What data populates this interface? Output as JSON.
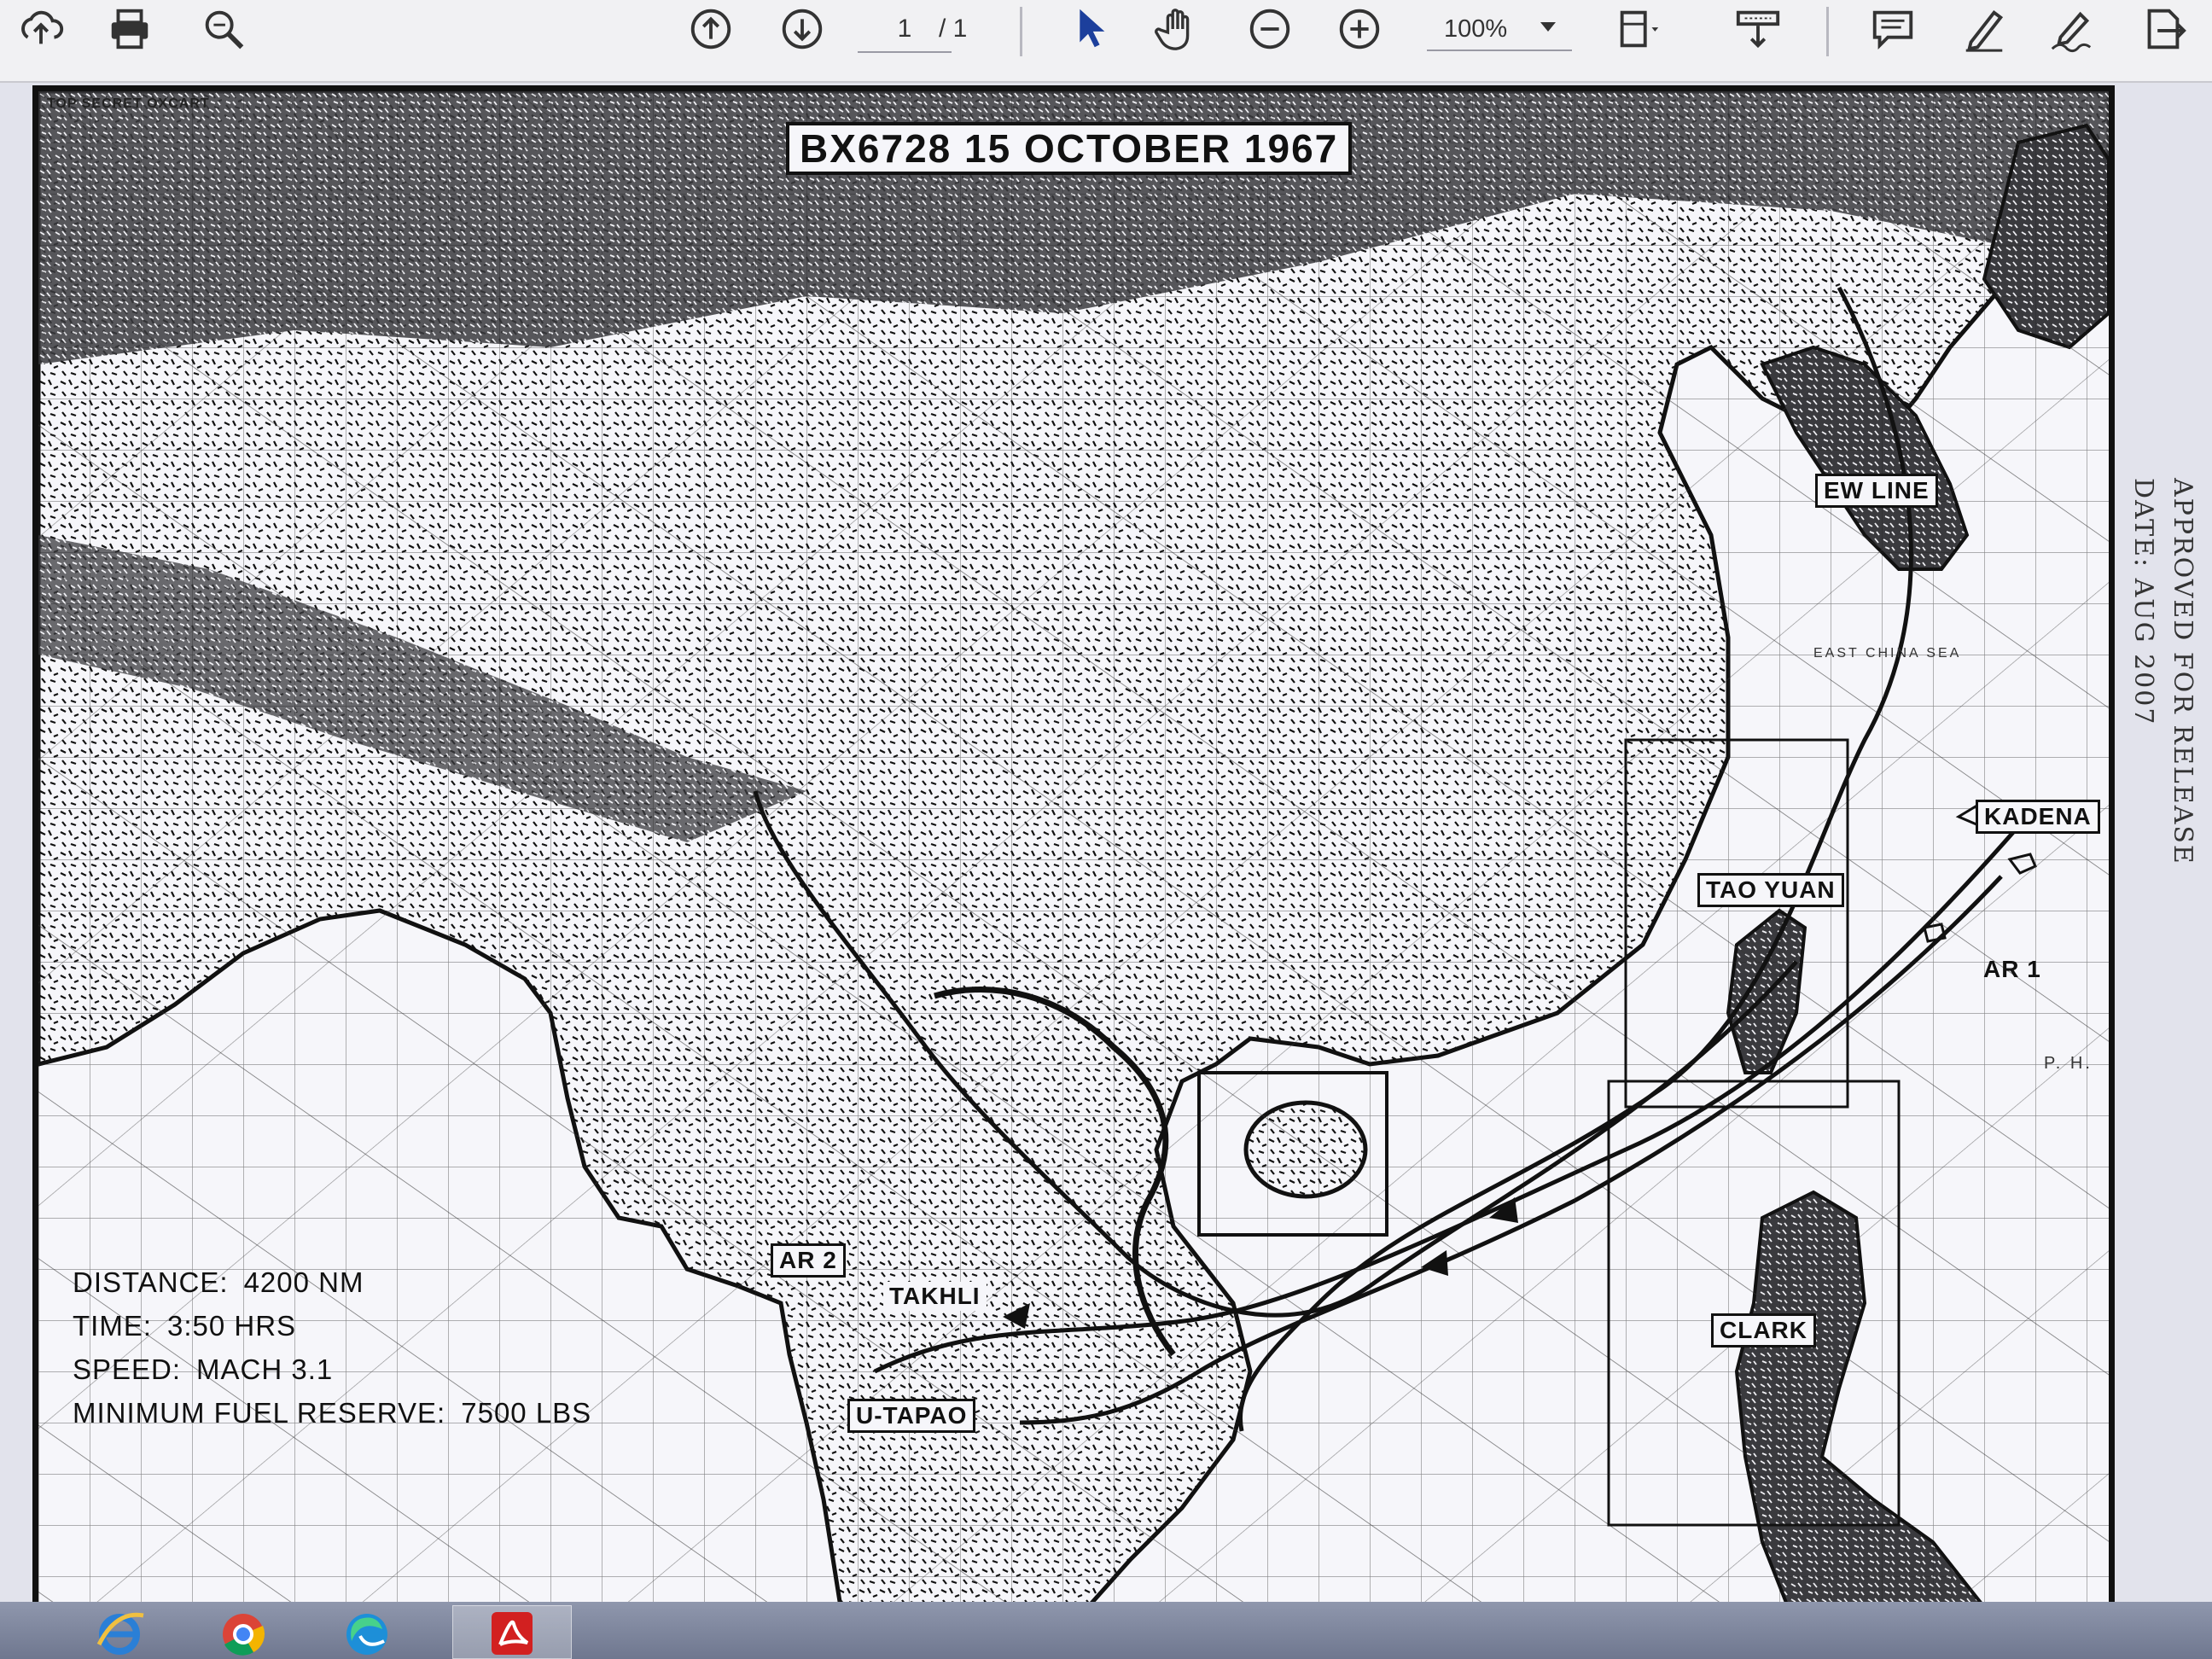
{
  "toolbar": {
    "page_current": "1",
    "page_total": "/ 1",
    "zoom": "100%",
    "icons": [
      "upload-icon",
      "print-icon",
      "zoom-search-icon",
      "page-up-icon",
      "page-down-icon",
      "select-arrow-icon",
      "hand-tool-icon",
      "zoom-out-icon",
      "zoom-in-icon",
      "fit-page-icon",
      "download-icon",
      "comment-icon",
      "highlight-pen-icon",
      "sign-icon",
      "export-icon"
    ]
  },
  "map": {
    "header": "TOP SECRET OXCART",
    "title": "BX6728  15 OCTOBER 1967",
    "labels": {
      "ew_line": "EW LINE",
      "kadena": "KADENA",
      "tao_yuan": "TAO YUAN",
      "ar1": "AR 1",
      "ar2": "AR 2",
      "takhli": "TAKHLI",
      "u_tapao": "U-TAPAO",
      "clark": "CLARK"
    },
    "sea_label": "EAST CHINA SEA",
    "ph_label": "P. H.",
    "stats": [
      {
        "key": "DISTANCE:",
        "value": "4200 NM"
      },
      {
        "key": "TIME:",
        "value": "3:50 HRS"
      },
      {
        "key": "SPEED:",
        "value": "MACH 3.1"
      },
      {
        "key": "MINIMUM FUEL RESERVE:",
        "value": "7500 LBS"
      }
    ],
    "stamp_line1": "APPROVED FOR RELEASE",
    "stamp_line2": "DATE: AUG 2007"
  },
  "taskbar": {
    "items": [
      "internet-explorer-icon",
      "chrome-icon",
      "edge-icon",
      "acrobat-reader-icon"
    ]
  }
}
